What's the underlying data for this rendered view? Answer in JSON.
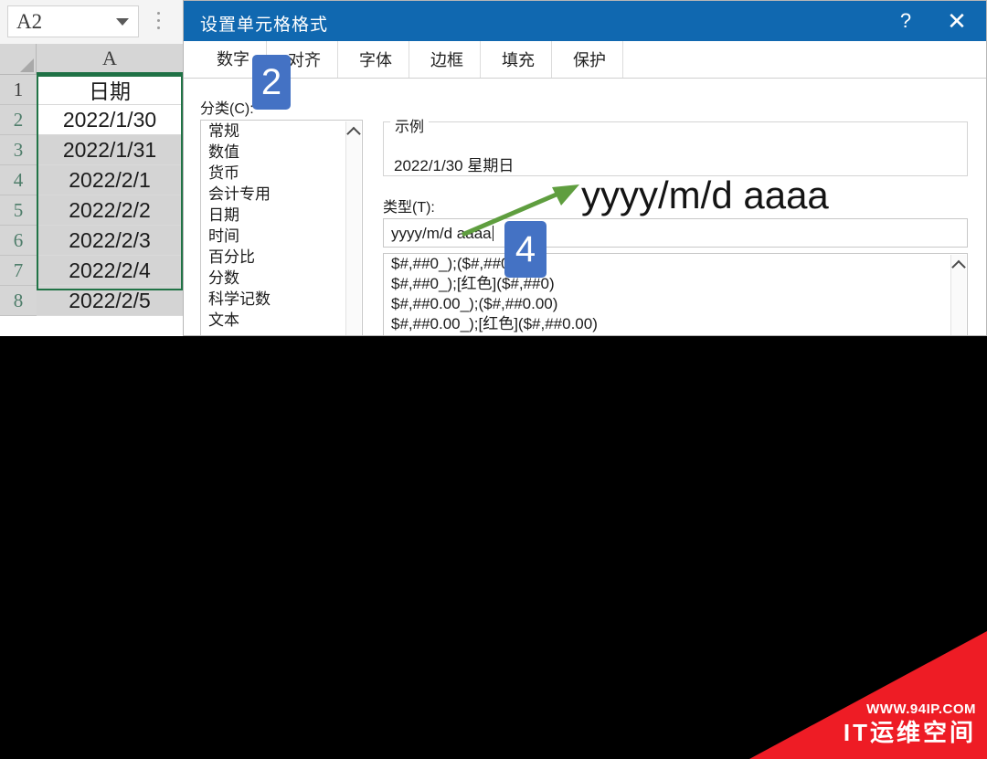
{
  "excel": {
    "name_box": {
      "value": "A2",
      "chevron_icon": "chevron-down-icon",
      "more_icon": "vertical-dots-icon"
    },
    "column_header": "A",
    "rows": [
      {
        "number": "1",
        "value": "日期",
        "state": "header"
      },
      {
        "number": "2",
        "value": "2022/1/30",
        "state": "active"
      },
      {
        "number": "3",
        "value": "2022/1/31",
        "state": "selected"
      },
      {
        "number": "4",
        "value": "2022/2/1",
        "state": "selected"
      },
      {
        "number": "5",
        "value": "2022/2/2",
        "state": "selected"
      },
      {
        "number": "6",
        "value": "2022/2/3",
        "state": "selected"
      },
      {
        "number": "7",
        "value": "2022/2/4",
        "state": "selected"
      },
      {
        "number": "8",
        "value": "2022/2/5",
        "state": "selected"
      }
    ],
    "selection_color": "#217346"
  },
  "dialog": {
    "title": "设置单元格格式",
    "titlebar_color": "#1068b0",
    "help_icon": "?",
    "close_icon": "✕",
    "tabs": [
      {
        "label": "数字",
        "active": true
      },
      {
        "label": "对齐",
        "active": false
      },
      {
        "label": "字体",
        "active": false
      },
      {
        "label": "边框",
        "active": false
      },
      {
        "label": "填充",
        "active": false
      },
      {
        "label": "保护",
        "active": false
      }
    ],
    "category": {
      "label": "分类(C):",
      "items": [
        "常规",
        "数值",
        "货币",
        "会计专用",
        "日期",
        "时间",
        "百分比",
        "分数",
        "科学记数",
        "文本"
      ],
      "scroll_icon": "chevron-up-icon"
    },
    "sample": {
      "legend": "示例",
      "value": "2022/1/30 星期日"
    },
    "type": {
      "label": "类型(T):",
      "value": "yyyy/m/d aaaa"
    },
    "format_list": {
      "items": [
        "$#,##0_);($#,##0)",
        "$#,##0_);[红色]($#,##0)",
        "$#,##0.00_);($#,##0.00)",
        "$#,##0.00_);[红色]($#,##0.00)"
      ],
      "scroll_icon": "chevron-up-icon"
    }
  },
  "annotations": {
    "badge_color": "#4472c4",
    "badges": [
      {
        "number": "2"
      },
      {
        "number": "4"
      }
    ],
    "callout_text": "yyyy/m/d aaaa",
    "arrow_color": "#5f9e3f"
  },
  "watermark": {
    "url": "WWW.94IP.COM",
    "name": "IT运维空间",
    "color": "#ee1c25"
  }
}
